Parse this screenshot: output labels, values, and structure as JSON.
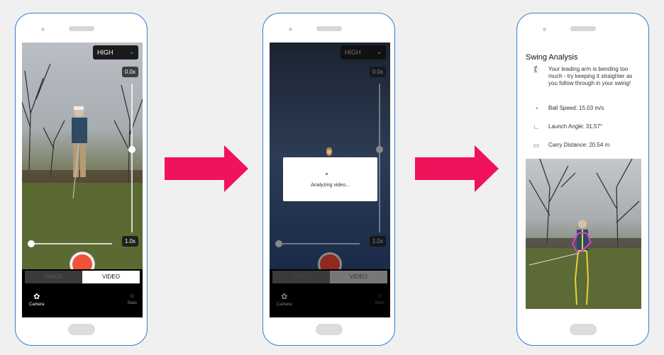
{
  "camera": {
    "quality": "HIGH",
    "zoom_max": "0.0x",
    "zoom_current": "1.0x",
    "mode_tabs": [
      "IMAGE",
      "VIDEO"
    ],
    "active_tab": "VIDEO",
    "nav_camera": "Camera",
    "nav_stats": "Stats"
  },
  "analyzing": {
    "quality": "HIGH",
    "zoom_max": "0.0x",
    "zoom_current": "1.0x",
    "mode_tabs": [
      "IMAGE",
      "VIDEO"
    ],
    "message": "Analyzing video...",
    "nav_camera": "Camera",
    "nav_stats": "Stats"
  },
  "analysis": {
    "title": "Swing Analysis",
    "items": [
      {
        "icon": "swing-figure-icon",
        "text": "Your leading arm is bending too much - try keeping it straighter as you follow through in your swing!"
      },
      {
        "icon": "speedometer-icon",
        "text": "Ball Speed: 15.03 m/s"
      },
      {
        "icon": "angle-icon",
        "text": "Launch Angle: 31.57°"
      },
      {
        "icon": "ruler-icon",
        "text": "Carry Distance: 20.54 m"
      }
    ]
  },
  "colors": {
    "arrow": "#f0125a",
    "phone_border": "#2f7fd6",
    "record": "#f0533a",
    "skeleton_arm": "#d63fd6",
    "skeleton_body": "#e7d23a"
  }
}
